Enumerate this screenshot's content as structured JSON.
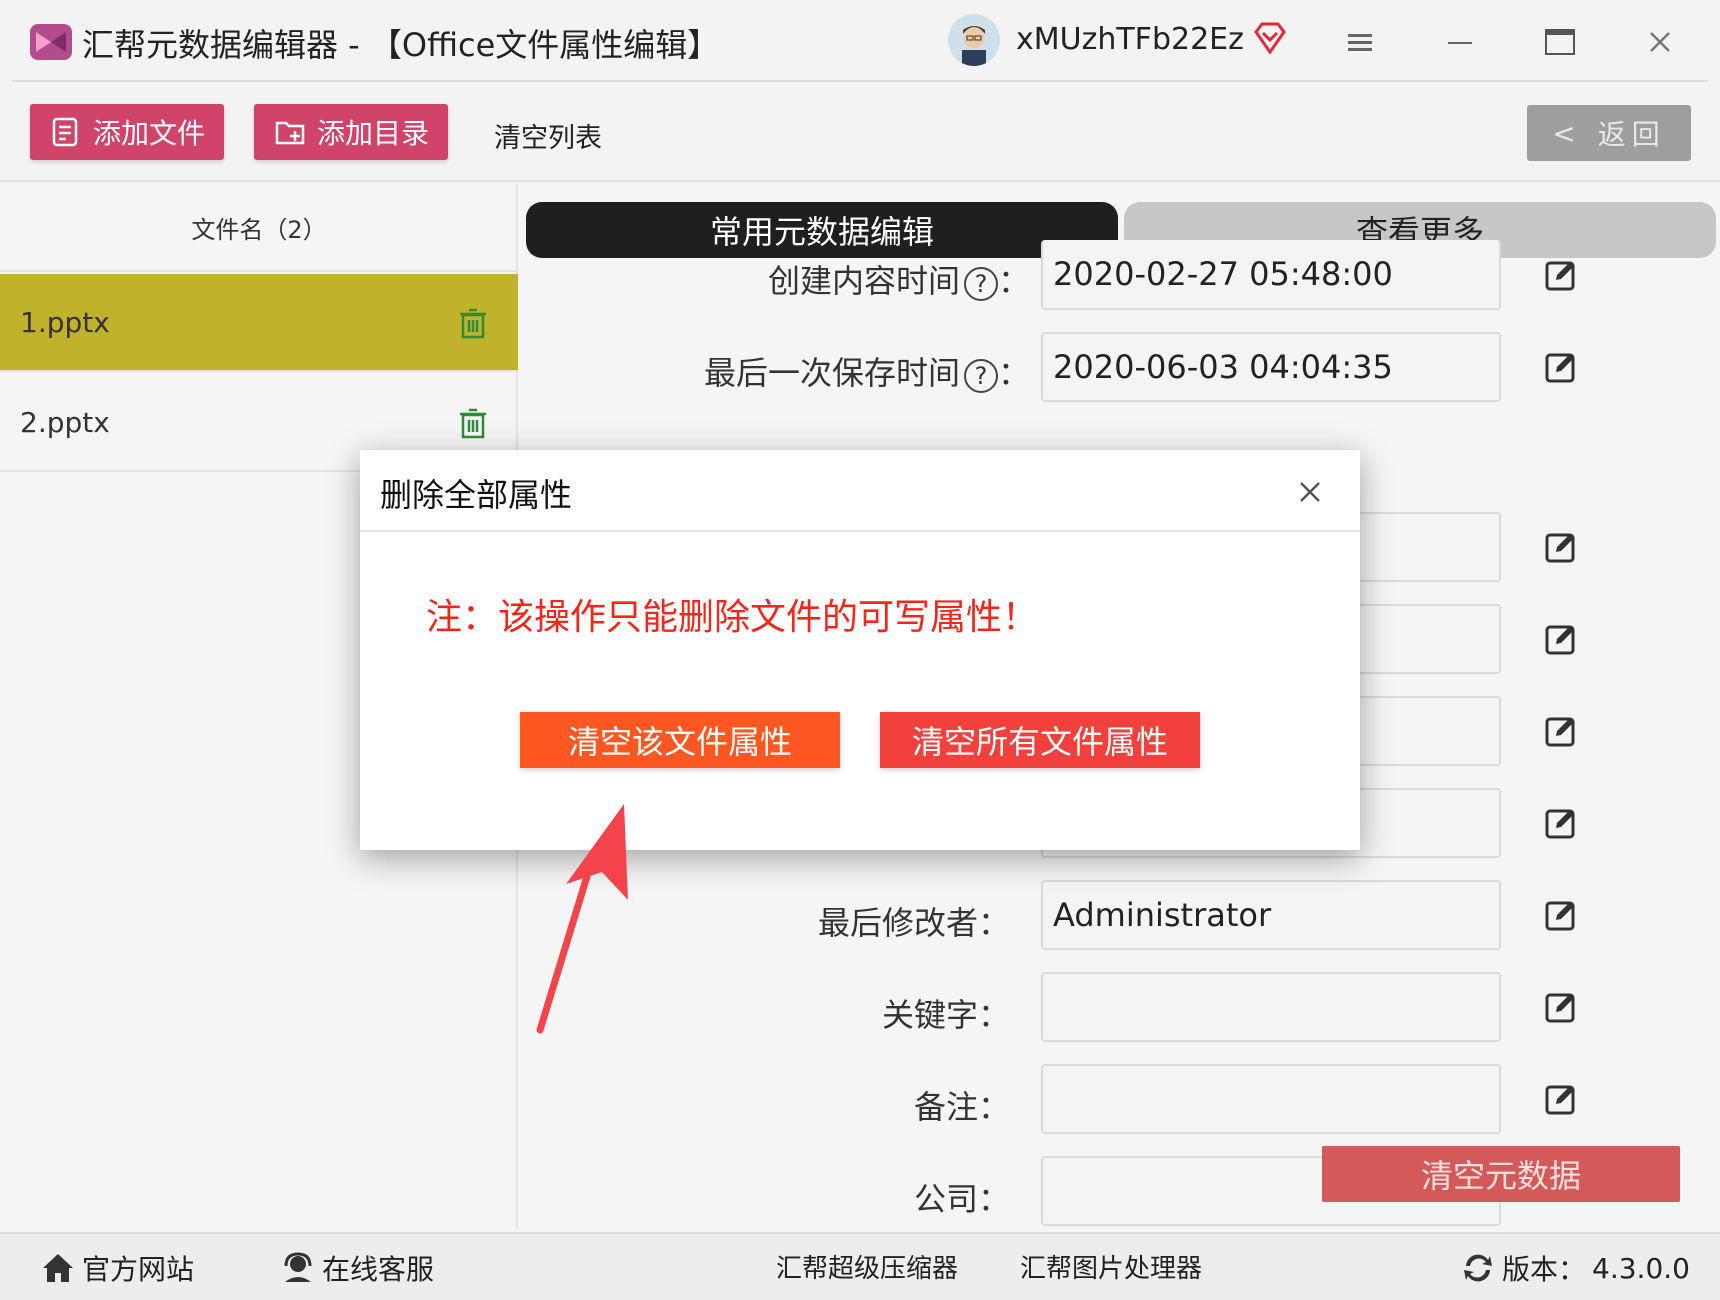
{
  "window": {
    "title": "汇帮元数据编辑器 - 【Office文件属性编辑】",
    "username": "xMUzhTFb22Ez",
    "controls": [
      "menu-icon",
      "minimize-icon",
      "maximize-icon",
      "close-icon"
    ]
  },
  "toolbar": {
    "add_file": "添加文件",
    "add_folder": "添加目录",
    "clear_list": "清空列表",
    "back": "返回",
    "accent_color": "#d14469"
  },
  "file_list": {
    "header": "文件名（2）",
    "items": [
      {
        "name": "1.pptx",
        "selected": true
      },
      {
        "name": "2.pptx",
        "selected": false
      }
    ]
  },
  "tabs": {
    "common": "常用元数据编辑",
    "more": "查看更多"
  },
  "fields": {
    "created_label": "创建内容时间",
    "created_value": "2020-02-27 05:48:00",
    "saved_label": "最后一次保存时间",
    "saved_value": "2020-06-03 04:04:35",
    "modifier_label": "最后修改者：",
    "modifier_value": "Administrator",
    "keywords_label": "关键字：",
    "keywords_value": "",
    "comments_label": "备注：",
    "comments_value": "",
    "company_label": "公司：",
    "company_value": "",
    "help_glyph": "?",
    "colon": "："
  },
  "clear_metadata": "清空元数据",
  "dialog": {
    "title": "删除全部属性",
    "warning": "注：该操作只能删除文件的可写属性！",
    "btn_clear_this": "清空该文件属性",
    "btn_clear_all": "清空所有文件属性",
    "warning_color": "#f2261a"
  },
  "statusbar": {
    "website": "官方网站",
    "support": "在线客服",
    "compressor": "汇帮超级压缩器",
    "image_tool": "汇帮图片处理器",
    "version_label": "版本：",
    "version": "4.3.0.0"
  }
}
